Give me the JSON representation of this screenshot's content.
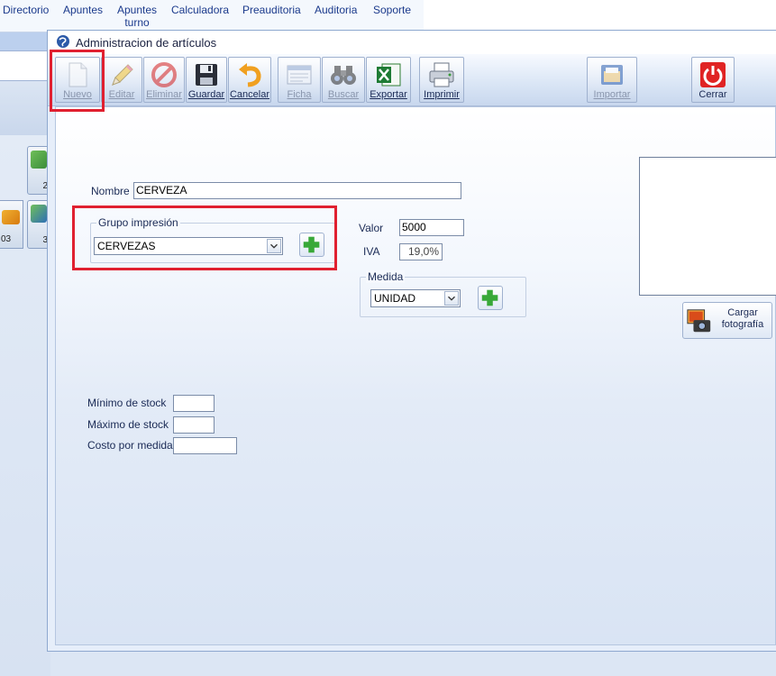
{
  "menu": {
    "items": [
      "Directorio",
      "Apuntes",
      "Apuntes turno",
      "Calculadora",
      "Preauditoria",
      "Auditoria",
      "Soporte"
    ],
    "apuntes_turno_line1": "Apuntes",
    "apuntes_turno_line2": "turno"
  },
  "background": {
    "tile1_number": "2",
    "tile2_number": "3",
    "left_tile_number": "03"
  },
  "dialog": {
    "title": "Administracion de artículos",
    "toolbar": [
      {
        "label": "Nuevo",
        "icon": "new-document-icon",
        "enabled": false
      },
      {
        "label": "Editar",
        "icon": "pencil-icon",
        "enabled": false
      },
      {
        "label": "Eliminar",
        "icon": "delete-icon",
        "enabled": false
      },
      {
        "label": "Guardar",
        "icon": "floppy-disk-icon",
        "enabled": true
      },
      {
        "label": "Cancelar",
        "icon": "undo-arrow-icon",
        "enabled": true
      },
      {
        "label": "Ficha",
        "icon": "card-icon",
        "enabled": false
      },
      {
        "label": "Buscar",
        "icon": "binoculars-icon",
        "enabled": false
      },
      {
        "label": "Exportar",
        "icon": "excel-icon",
        "enabled": true
      },
      {
        "label": "Imprimir",
        "icon": "printer-icon",
        "enabled": true
      },
      {
        "label": "Importar",
        "icon": "folder-icon",
        "enabled": false
      },
      {
        "label": "Cerrar",
        "icon": "power-icon",
        "enabled": true
      }
    ],
    "form": {
      "nombre_label": "Nombre",
      "nombre_value": "CERVEZA",
      "grupo_label": "Grupo impresión",
      "grupo_value": "CERVEZAS",
      "valor_label": "Valor",
      "valor_value": "5000",
      "iva_label": "IVA",
      "iva_value": "19,0%",
      "medida_label": "Medida",
      "medida_value": "UNIDAD",
      "minimo_label": "Mínimo de stock",
      "minimo_value": "",
      "maximo_label": "Máximo de stock",
      "maximo_value": "",
      "costo_label": "Costo por medida",
      "costo_value": "",
      "photo_button_line1": "Cargar",
      "photo_button_line2": "fotografía"
    }
  },
  "colors": {
    "highlight": "#e02030",
    "accent_blue": "#1b3a8c"
  }
}
